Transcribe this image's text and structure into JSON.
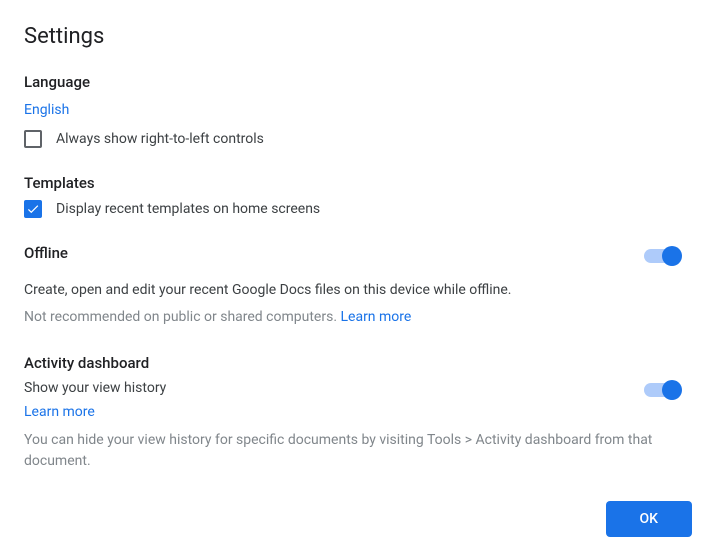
{
  "title": "Settings",
  "language": {
    "heading": "Language",
    "value": "English",
    "rtl_label": "Always show right-to-left controls",
    "rtl_checked": false
  },
  "templates": {
    "heading": "Templates",
    "recent_label": "Display recent templates on home screens",
    "recent_checked": true
  },
  "offline": {
    "heading": "Offline",
    "desc": "Create, open and edit your recent Google Docs files on this device while offline.",
    "warning": "Not recommended on public or shared computers. ",
    "learn_more": "Learn more",
    "enabled": true
  },
  "activity": {
    "heading": "Activity dashboard",
    "label": "Show your view history",
    "learn_more": "Learn more",
    "footnote": "You can hide your view history for specific documents by visiting Tools > Activity dashboard from that document.",
    "enabled": true
  },
  "footer": {
    "ok_label": "OK"
  }
}
